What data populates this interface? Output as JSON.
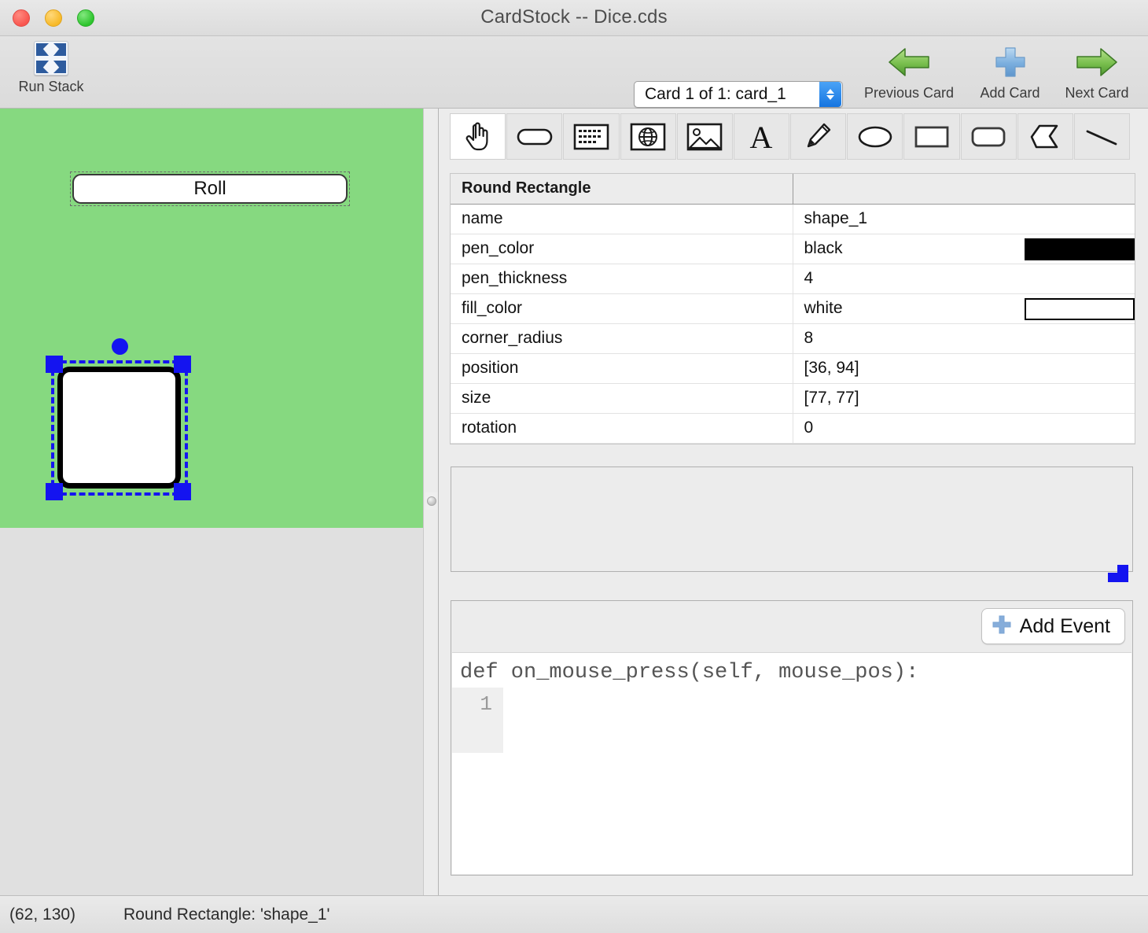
{
  "window": {
    "title": "CardStock -- Dice.cds",
    "traffic_lights": [
      "close",
      "minimize",
      "zoom"
    ]
  },
  "toolbar": {
    "run_stack_label": "Run Stack",
    "run_stack_icon": "expand-arrows-icon",
    "card_selector": {
      "value": "Card 1 of 1: card_1",
      "options": [
        "Card 1 of 1: card_1"
      ]
    },
    "previous_card_label": "Previous Card",
    "previous_card_icon": "left-arrow-icon",
    "add_card_label": "Add Card",
    "add_card_icon": "plus-icon",
    "next_card_label": "Next Card",
    "next_card_icon": "right-arrow-icon"
  },
  "canvas": {
    "card_background_color": "#86d980",
    "button": {
      "label": "Roll",
      "name": "button_1",
      "selected": false
    },
    "selected_shape": {
      "type": "Round Rectangle",
      "name": "shape_1",
      "fill_color": "#ffffff",
      "pen_color": "#000000",
      "selection_color": "#1414f0"
    }
  },
  "palette": {
    "tools": [
      {
        "name": "hand-tool",
        "icon": "hand-pointer-icon",
        "selected": true
      },
      {
        "name": "button-tool",
        "icon": "rounded-pill-icon",
        "selected": false
      },
      {
        "name": "textfield-tool",
        "icon": "text-field-icon",
        "selected": false
      },
      {
        "name": "webview-tool",
        "icon": "globe-icon",
        "selected": false
      },
      {
        "name": "image-tool",
        "icon": "picture-icon",
        "selected": false
      },
      {
        "name": "textlabel-tool",
        "icon": "letter-a-icon",
        "selected": false
      },
      {
        "name": "pen-tool",
        "icon": "pencil-icon",
        "selected": false
      },
      {
        "name": "oval-tool",
        "icon": "ellipse-icon",
        "selected": false
      },
      {
        "name": "rectangle-tool",
        "icon": "rectangle-icon",
        "selected": false
      },
      {
        "name": "round-rectangle-tool",
        "icon": "round-rectangle-icon",
        "selected": false
      },
      {
        "name": "polygon-tool",
        "icon": "polygon-icon",
        "selected": false
      },
      {
        "name": "line-tool",
        "icon": "line-icon",
        "selected": false
      }
    ]
  },
  "properties": {
    "header": {
      "type": "Round Rectangle",
      "value_column": ""
    },
    "rows": [
      {
        "key": "name",
        "value": "shape_1",
        "swatch": null
      },
      {
        "key": "pen_color",
        "value": "black",
        "swatch": "#000000"
      },
      {
        "key": "pen_thickness",
        "value": "4",
        "swatch": null
      },
      {
        "key": "fill_color",
        "value": "white",
        "swatch": "#ffffff"
      },
      {
        "key": "corner_radius",
        "value": "8",
        "swatch": null
      },
      {
        "key": "position",
        "value": "[36, 94]",
        "swatch": null
      },
      {
        "key": "size",
        "value": "[77, 77]",
        "swatch": null
      },
      {
        "key": "rotation",
        "value": "0",
        "swatch": null
      }
    ]
  },
  "editor": {
    "add_event_label": "Add Event",
    "add_event_icon": "plus-icon",
    "handler_signature": "def on_mouse_press(self, mouse_pos):",
    "line_numbers": [
      "1"
    ],
    "code_lines": [
      ""
    ]
  },
  "status": {
    "coordinates": "(62, 130)",
    "selection": "Round Rectangle: 'shape_1'"
  }
}
